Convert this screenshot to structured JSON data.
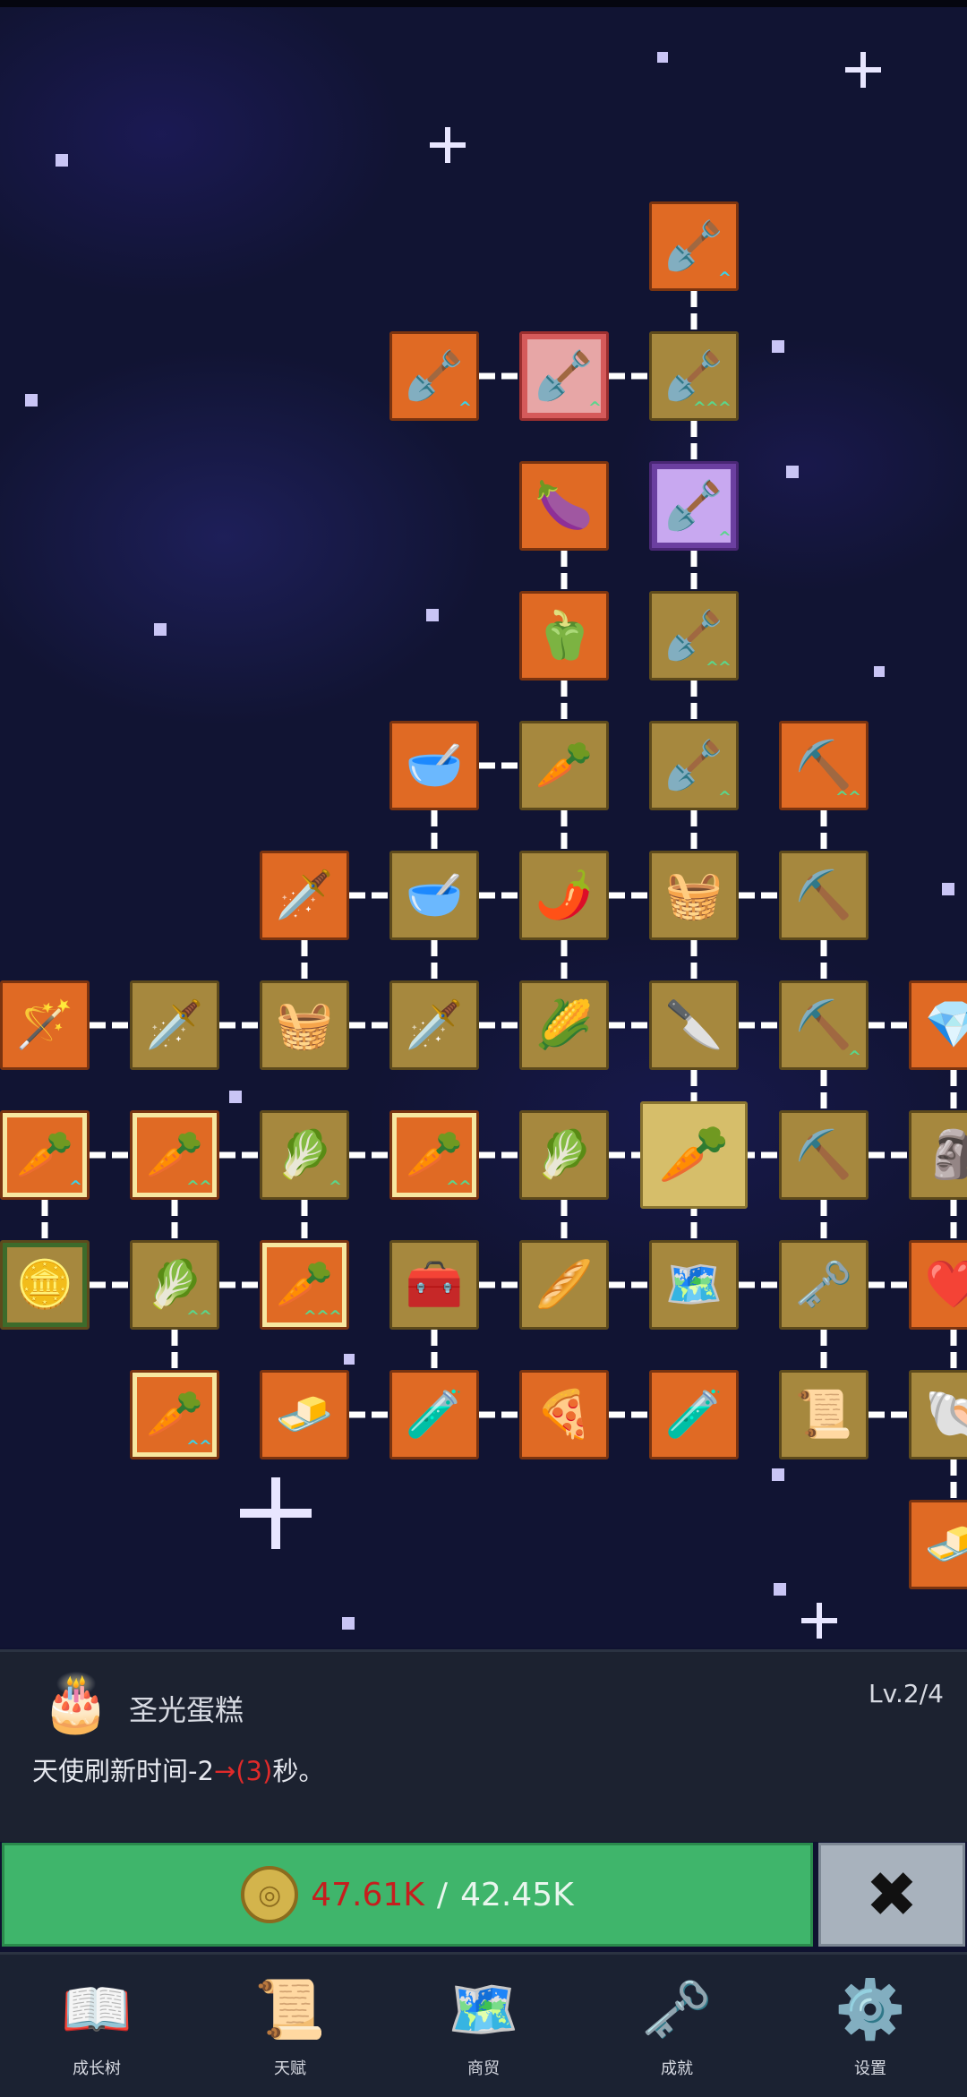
{
  "tree_nodes": [
    {
      "id": "n1",
      "icon": "shovel-icon",
      "glyph": "🪏",
      "bg": "orange",
      "level": "up1b",
      "col": 5,
      "row": 0
    },
    {
      "id": "n2",
      "icon": "shovel-icon",
      "glyph": "🪏",
      "bg": "orange",
      "level": "up1b",
      "col": 3,
      "row": 1
    },
    {
      "id": "n3",
      "icon": "shovel-icon",
      "glyph": "🪏",
      "bg": "red-frame",
      "level": "up1g",
      "col": 4,
      "row": 1
    },
    {
      "id": "n4",
      "icon": "shovel-icon",
      "glyph": "🪏",
      "bg": "gold",
      "level": "up3g",
      "col": 5,
      "row": 1
    },
    {
      "id": "n5",
      "icon": "eggplant-icon",
      "glyph": "🍆",
      "bg": "orange",
      "level": "",
      "col": 4,
      "row": 2
    },
    {
      "id": "n6",
      "icon": "shovel-icon",
      "glyph": "🪏",
      "bg": "purple-frame",
      "level": "up1g",
      "col": 5,
      "row": 2
    },
    {
      "id": "n7",
      "icon": "bell-pepper-icon",
      "glyph": "🫑",
      "bg": "orange",
      "level": "",
      "col": 4,
      "row": 3
    },
    {
      "id": "n8",
      "icon": "shovel-icon",
      "glyph": "🪏",
      "bg": "gold",
      "level": "up2g",
      "col": 5,
      "row": 3
    },
    {
      "id": "n9",
      "icon": "bowl-icon",
      "glyph": "🥣",
      "bg": "orange",
      "level": "",
      "col": 3,
      "row": 4
    },
    {
      "id": "n10",
      "icon": "radish-icon",
      "glyph": "🥕",
      "bg": "gold",
      "level": "",
      "col": 4,
      "row": 4
    },
    {
      "id": "n11",
      "icon": "shovel-icon",
      "glyph": "🪏",
      "bg": "gold",
      "level": "up1g",
      "col": 5,
      "row": 4
    },
    {
      "id": "n12",
      "icon": "pickaxe-icon",
      "glyph": "⛏️",
      "bg": "orange",
      "level": "up2g",
      "col": 6,
      "row": 4
    },
    {
      "id": "n13",
      "icon": "sword-icon",
      "glyph": "🗡️",
      "bg": "orange",
      "level": "",
      "col": 2,
      "row": 5
    },
    {
      "id": "n14",
      "icon": "bowl-icon",
      "glyph": "🥣",
      "bg": "gold",
      "level": "",
      "col": 3,
      "row": 5
    },
    {
      "id": "n15",
      "icon": "chili-icon",
      "glyph": "🌶️",
      "bg": "gold",
      "level": "",
      "col": 4,
      "row": 5
    },
    {
      "id": "n16",
      "icon": "basket-icon",
      "glyph": "🧺",
      "bg": "gold",
      "level": "",
      "col": 5,
      "row": 5
    },
    {
      "id": "n17",
      "icon": "pickaxe-icon",
      "glyph": "⛏️",
      "bg": "gold",
      "level": "",
      "col": 6,
      "row": 5
    },
    {
      "id": "n18",
      "icon": "wand-icon",
      "glyph": "🪄",
      "bg": "orange",
      "level": "",
      "col": 0,
      "row": 6
    },
    {
      "id": "n19",
      "icon": "sword-icon",
      "glyph": "🗡️",
      "bg": "gold",
      "level": "",
      "col": 1,
      "row": 6
    },
    {
      "id": "n20",
      "icon": "basket-icon",
      "glyph": "🧺",
      "bg": "gold",
      "level": "",
      "col": 2,
      "row": 6
    },
    {
      "id": "n21",
      "icon": "sword-icon",
      "glyph": "🗡️",
      "bg": "gold",
      "level": "",
      "col": 3,
      "row": 6
    },
    {
      "id": "n22",
      "icon": "corn-icon",
      "glyph": "🌽",
      "bg": "gold",
      "level": "",
      "col": 4,
      "row": 6
    },
    {
      "id": "n23",
      "icon": "dagger-icon",
      "glyph": "🔪",
      "bg": "gold",
      "level": "",
      "col": 5,
      "row": 6
    },
    {
      "id": "n24",
      "icon": "pickaxe-icon",
      "glyph": "⛏️",
      "bg": "gold",
      "level": "up1g",
      "col": 6,
      "row": 6
    },
    {
      "id": "n25",
      "icon": "crystal-icon",
      "glyph": "💎",
      "bg": "orange",
      "level": "",
      "col": 7,
      "row": 6
    },
    {
      "id": "n26",
      "icon": "carrot-icon",
      "glyph": "🥕",
      "bg": "yellow-frame",
      "level": "up1b",
      "col": 0,
      "row": 7
    },
    {
      "id": "n27",
      "icon": "carrot-icon",
      "glyph": "🥕",
      "bg": "yellow-frame",
      "level": "up2g",
      "col": 1,
      "row": 7
    },
    {
      "id": "n28",
      "icon": "cabbage-icon",
      "glyph": "🥬",
      "bg": "gold",
      "level": "up1g",
      "col": 2,
      "row": 7
    },
    {
      "id": "n29",
      "icon": "carrot-icon",
      "glyph": "🥕",
      "bg": "yellow-frame",
      "level": "up2g",
      "col": 3,
      "row": 7
    },
    {
      "id": "n30",
      "icon": "cabbage-icon",
      "glyph": "🥬",
      "bg": "gold",
      "level": "",
      "col": 4,
      "row": 7
    },
    {
      "id": "n31",
      "icon": "carrot-icon",
      "glyph": "🥕",
      "bg": "selected",
      "level": "",
      "col": 5,
      "row": 7
    },
    {
      "id": "n32",
      "icon": "pickaxe-icon",
      "glyph": "⛏️",
      "bg": "gold",
      "level": "",
      "col": 6,
      "row": 7
    },
    {
      "id": "n33",
      "icon": "statue-icon",
      "glyph": "🗿",
      "bg": "gold",
      "level": "",
      "col": 7,
      "row": 7
    },
    {
      "id": "n34",
      "icon": "gold-coin-icon",
      "glyph": "🪙",
      "bg": "green-frame",
      "level": "",
      "col": 0,
      "row": 8
    },
    {
      "id": "n35",
      "icon": "cabbage-icon",
      "glyph": "🥬",
      "bg": "gold",
      "level": "up2g",
      "col": 1,
      "row": 8
    },
    {
      "id": "n36",
      "icon": "carrot-icon",
      "glyph": "🥕",
      "bg": "yellow-frame",
      "level": "up3g",
      "col": 2,
      "row": 8
    },
    {
      "id": "n37",
      "icon": "treasure-chest-icon",
      "glyph": "🧰",
      "bg": "gold",
      "level": "",
      "col": 3,
      "row": 8
    },
    {
      "id": "n38",
      "icon": "parsnip-icon",
      "glyph": "🥖",
      "bg": "gold",
      "level": "",
      "col": 4,
      "row": 8
    },
    {
      "id": "n39",
      "icon": "map-icon",
      "glyph": "🗺️",
      "bg": "gold",
      "level": "",
      "col": 5,
      "row": 8
    },
    {
      "id": "n40",
      "icon": "key-icon",
      "glyph": "🗝️",
      "bg": "gold",
      "level": "",
      "col": 6,
      "row": 8
    },
    {
      "id": "n41",
      "icon": "heart-icon",
      "glyph": "❤️",
      "bg": "orange",
      "level": "",
      "col": 7,
      "row": 8
    },
    {
      "id": "n42",
      "icon": "carrot-icon",
      "glyph": "🥕",
      "bg": "yellow-frame",
      "level": "up2b",
      "col": 1,
      "row": 9
    },
    {
      "id": "n43",
      "icon": "gold-bar-icon",
      "glyph": "🧈",
      "bg": "orange",
      "level": "",
      "col": 2,
      "row": 9
    },
    {
      "id": "n44",
      "icon": "potion-icon",
      "glyph": "🧪",
      "bg": "orange",
      "level": "",
      "col": 3,
      "row": 9
    },
    {
      "id": "n45",
      "icon": "pizza-icon",
      "glyph": "🍕",
      "bg": "orange",
      "level": "",
      "col": 4,
      "row": 9
    },
    {
      "id": "n46",
      "icon": "potion-icon",
      "glyph": "🧪",
      "bg": "orange",
      "level": "",
      "col": 5,
      "row": 9
    },
    {
      "id": "n47",
      "icon": "scroll-icon",
      "glyph": "📜",
      "bg": "gold",
      "level": "",
      "col": 6,
      "row": 9
    },
    {
      "id": "n48",
      "icon": "fossil-icon",
      "glyph": "🐚",
      "bg": "gold",
      "level": "",
      "col": 7,
      "row": 9
    },
    {
      "id": "n49",
      "icon": "gold-bar-icon",
      "glyph": "🧈",
      "bg": "orange",
      "level": "",
      "col": 7,
      "row": 10
    }
  ],
  "tree_links": [
    [
      "n1",
      "n4"
    ],
    [
      "n2",
      "n3"
    ],
    [
      "n3",
      "n4"
    ],
    [
      "n4",
      "n6"
    ],
    [
      "n5",
      "n7"
    ],
    [
      "n6",
      "n8"
    ],
    [
      "n7",
      "n10"
    ],
    [
      "n8",
      "n11"
    ],
    [
      "n9",
      "n10"
    ],
    [
      "n9",
      "n14"
    ],
    [
      "n10",
      "n15"
    ],
    [
      "n11",
      "n16"
    ],
    [
      "n12",
      "n17"
    ],
    [
      "n13",
      "n14"
    ],
    [
      "n14",
      "n15"
    ],
    [
      "n15",
      "n16"
    ],
    [
      "n16",
      "n17"
    ],
    [
      "n13",
      "n20"
    ],
    [
      "n14",
      "n21"
    ],
    [
      "n15",
      "n22"
    ],
    [
      "n16",
      "n23"
    ],
    [
      "n17",
      "n24"
    ],
    [
      "n18",
      "n19"
    ],
    [
      "n19",
      "n20"
    ],
    [
      "n20",
      "n21"
    ],
    [
      "n21",
      "n22"
    ],
    [
      "n22",
      "n23"
    ],
    [
      "n23",
      "n24"
    ],
    [
      "n24",
      "n25"
    ],
    [
      "n23",
      "n31"
    ],
    [
      "n24",
      "n32"
    ],
    [
      "n25",
      "n33"
    ],
    [
      "n26",
      "n27"
    ],
    [
      "n27",
      "n28"
    ],
    [
      "n28",
      "n29"
    ],
    [
      "n29",
      "n30"
    ],
    [
      "n30",
      "n31"
    ],
    [
      "n31",
      "n32"
    ],
    [
      "n32",
      "n33"
    ],
    [
      "n26",
      "n34"
    ],
    [
      "n27",
      "n35"
    ],
    [
      "n28",
      "n36"
    ],
    [
      "n30",
      "n38"
    ],
    [
      "n31",
      "n39"
    ],
    [
      "n32",
      "n40"
    ],
    [
      "n33",
      "n41"
    ],
    [
      "n34",
      "n35"
    ],
    [
      "n35",
      "n36"
    ],
    [
      "n37",
      "n38"
    ],
    [
      "n38",
      "n39"
    ],
    [
      "n39",
      "n40"
    ],
    [
      "n40",
      "n41"
    ],
    [
      "n35",
      "n42"
    ],
    [
      "n37",
      "n44"
    ],
    [
      "n40",
      "n47"
    ],
    [
      "n41",
      "n48"
    ],
    [
      "n43",
      "n44"
    ],
    [
      "n44",
      "n45"
    ],
    [
      "n45",
      "n46"
    ],
    [
      "n47",
      "n48"
    ],
    [
      "n48",
      "n49"
    ]
  ],
  "info": {
    "icon": "cake-icon",
    "icon_glyph": "🎂",
    "name": "圣光蛋糕",
    "level": "Lv.2/4",
    "desc_prefix": "天使刷新时间-2",
    "desc_arrow": "→(3)",
    "desc_suffix": "秒。"
  },
  "purchase": {
    "coin_icon": "coin-icon",
    "have": "47.61K",
    "separator": "/",
    "need": "42.45K",
    "close_glyph": "✖"
  },
  "nav": [
    {
      "label": "成长树",
      "icon": "book-icon",
      "glyph": "📖"
    },
    {
      "label": "天赋",
      "icon": "scroll-icon",
      "glyph": "📜"
    },
    {
      "label": "商贸",
      "icon": "map-icon",
      "glyph": "🗺️"
    },
    {
      "label": "成就",
      "icon": "key-icon",
      "glyph": "🗝️"
    },
    {
      "label": "设置",
      "icon": "gear-icon",
      "glyph": "⚙️"
    }
  ],
  "colors": {
    "orange": "#e06a24",
    "gold": "#a6883e",
    "buy_green": "#3fb56b",
    "cost_red": "#c61e1e"
  }
}
